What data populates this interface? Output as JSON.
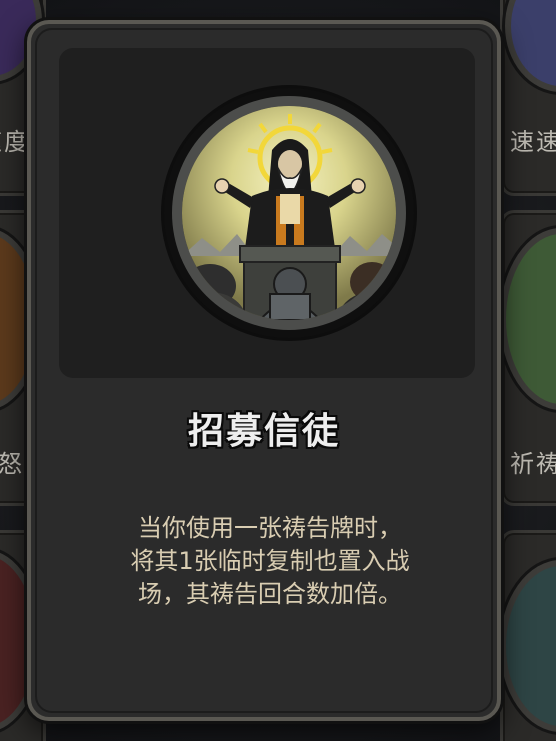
{
  "card": {
    "title": "招募信徒",
    "description_lines": [
      "当你使用一张祷告牌时，",
      "将其1张临时复制也置入战",
      "场，其祷告回合数加倍。"
    ],
    "portrait_icon": "priest-preaching-art"
  },
  "background_cards": {
    "left_top_label": "速度",
    "right_top_label": "速速",
    "left_mid_label": "怒",
    "right_mid_label": "祈祷"
  },
  "colors": {
    "card_bg": "#2b2b2b",
    "card_border": "#5a5852",
    "title_text": "#eeeeee",
    "description_text": "#d9cdb2",
    "halo": "#f2d73a"
  }
}
